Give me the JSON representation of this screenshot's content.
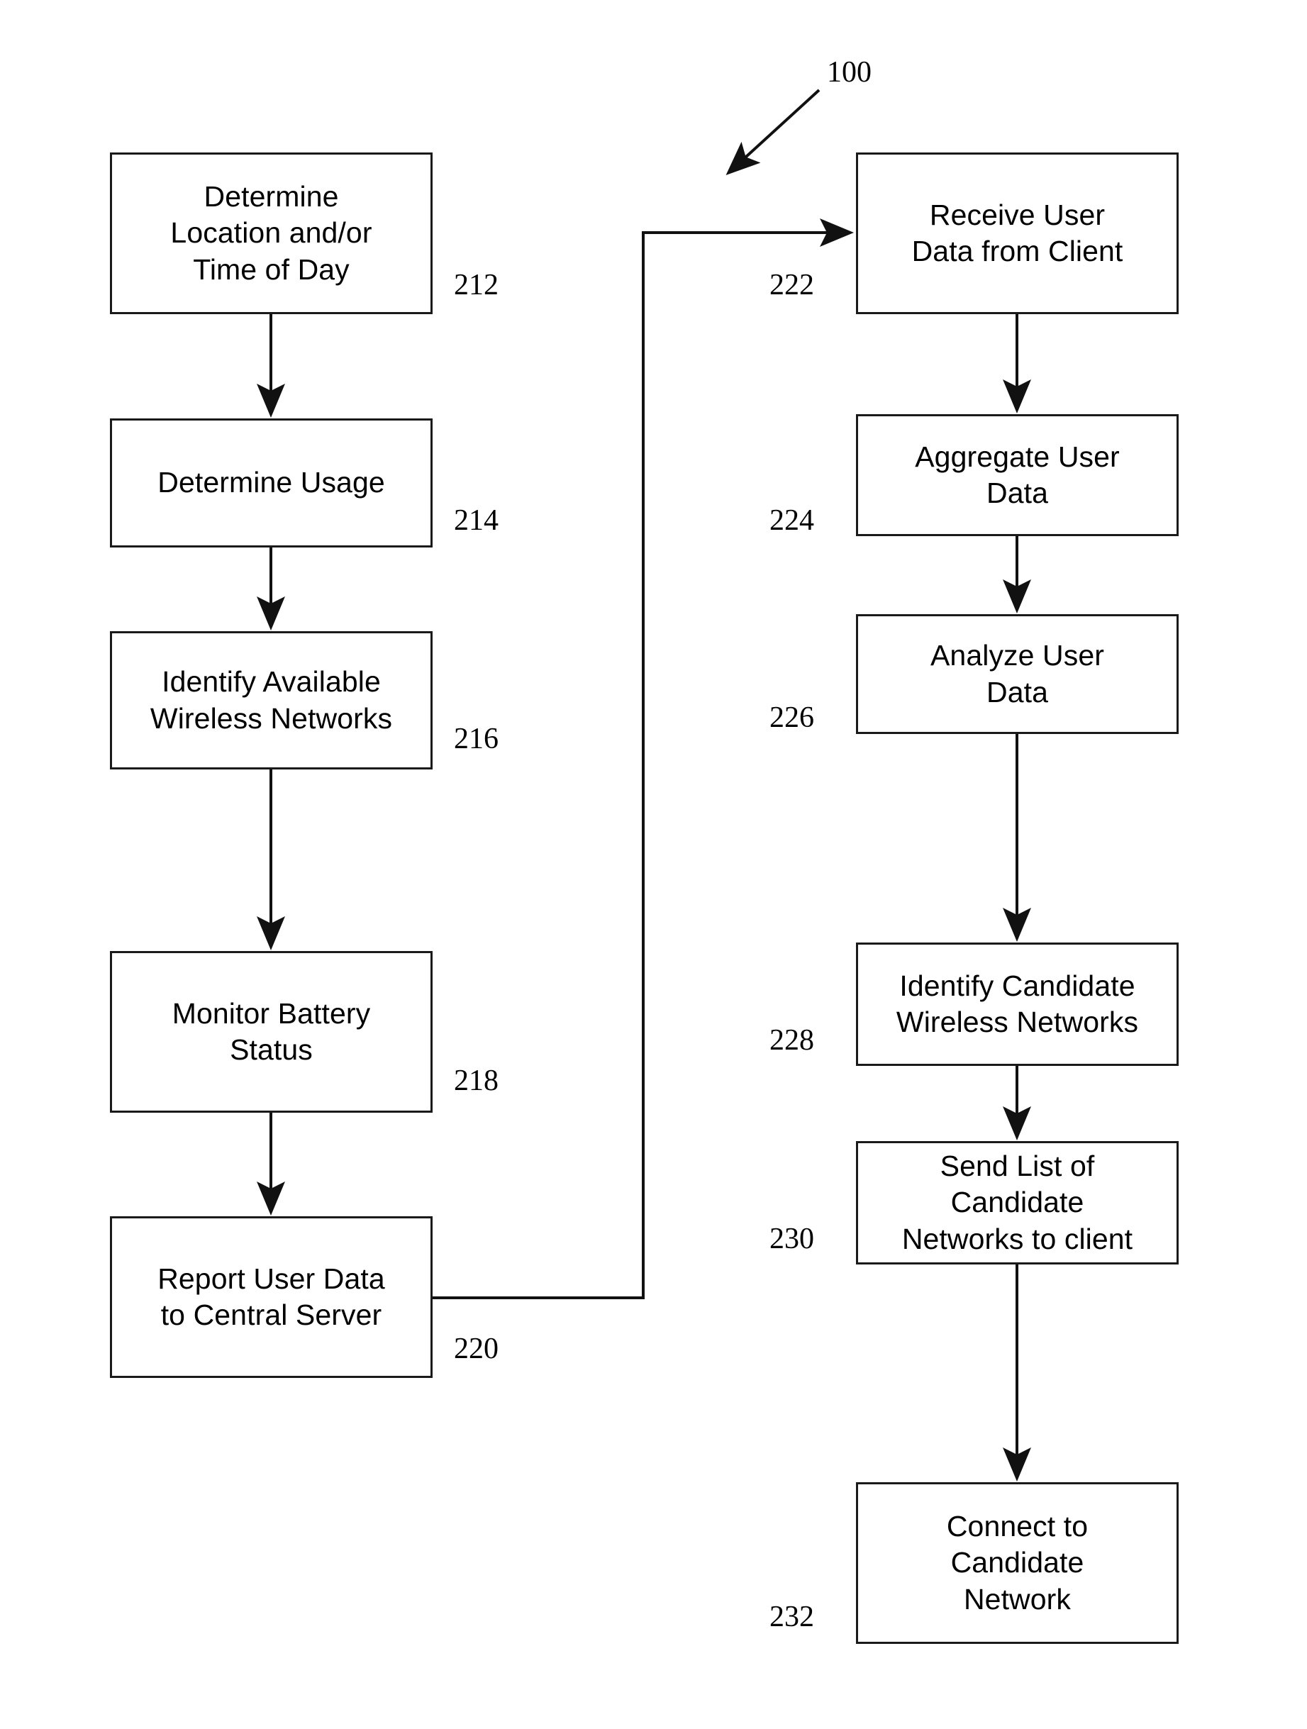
{
  "figure": {
    "reference_numeral": "100"
  },
  "client_column": {
    "steps": [
      {
        "id": "212",
        "label": "Determine\nLocation and/or\nTime of Day"
      },
      {
        "id": "214",
        "label": "Determine Usage"
      },
      {
        "id": "216",
        "label": "Identify Available\nWireless Networks"
      },
      {
        "id": "218",
        "label": "Monitor Battery\nStatus"
      },
      {
        "id": "220",
        "label": "Report User Data\nto Central Server"
      }
    ]
  },
  "server_column": {
    "steps": [
      {
        "id": "222",
        "label": "Receive User\nData from Client"
      },
      {
        "id": "224",
        "label": "Aggregate User\nData"
      },
      {
        "id": "226",
        "label": "Analyze User\nData"
      },
      {
        "id": "228",
        "label": "Identify Candidate\nWireless Networks"
      },
      {
        "id": "230",
        "label": "Send List of\nCandidate\nNetworks to client"
      },
      {
        "id": "232",
        "label": "Connect to\nCandidate\nNetwork"
      }
    ]
  },
  "colors": {
    "stroke": "#1a1a1a",
    "background": "#ffffff",
    "text": "#000000"
  }
}
